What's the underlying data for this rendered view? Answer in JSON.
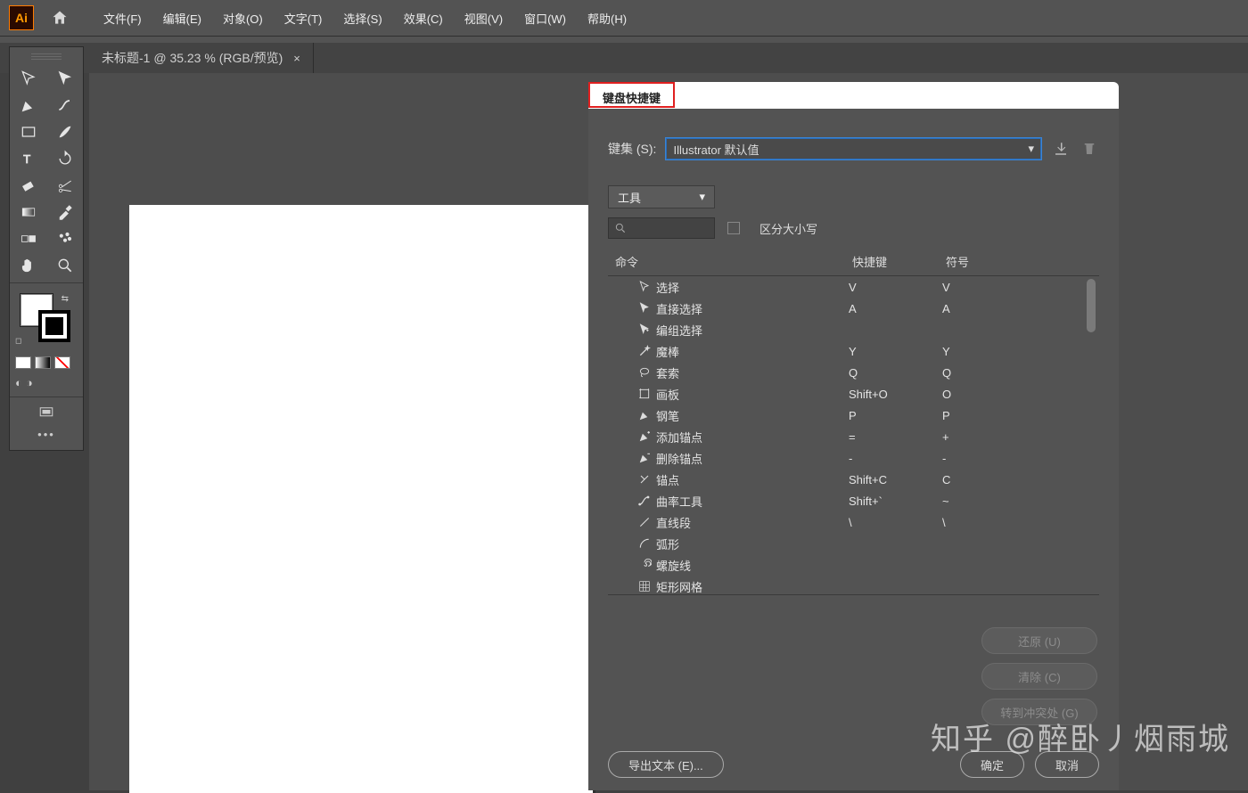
{
  "menubar": {
    "logo": "Ai",
    "items": [
      "文件(F)",
      "编辑(E)",
      "对象(O)",
      "文字(T)",
      "选择(S)",
      "效果(C)",
      "视图(V)",
      "窗口(W)",
      "帮助(H)"
    ]
  },
  "document_tab": {
    "title": "未标题-1 @ 35.23 % (RGB/预览)",
    "close": "×"
  },
  "dialog": {
    "title_tab": "键盘快捷键",
    "keyset_label": "键集 (S):",
    "keyset_value": "Illustrator 默认值",
    "filter_value": "工具",
    "case_sensitive_label": "区分大小写",
    "headers": {
      "command": "命令",
      "shortcut": "快捷键",
      "symbol": "符号"
    },
    "rows": [
      {
        "icon": "cursor",
        "cmd": "选择",
        "sc": "V",
        "sym": "V"
      },
      {
        "icon": "direct",
        "cmd": "直接选择",
        "sc": "A",
        "sym": "A"
      },
      {
        "icon": "group-sel",
        "cmd": "编组选择",
        "sc": "",
        "sym": ""
      },
      {
        "icon": "wand",
        "cmd": "魔棒",
        "sc": "Y",
        "sym": "Y"
      },
      {
        "icon": "lasso",
        "cmd": "套索",
        "sc": "Q",
        "sym": "Q"
      },
      {
        "icon": "artboard",
        "cmd": "画板",
        "sc": "Shift+O",
        "sym": "O"
      },
      {
        "icon": "pen",
        "cmd": "钢笔",
        "sc": "P",
        "sym": "P"
      },
      {
        "icon": "add-anchor",
        "cmd": "添加锚点",
        "sc": "=",
        "sym": "+"
      },
      {
        "icon": "del-anchor",
        "cmd": "删除锚点",
        "sc": "-",
        "sym": "-"
      },
      {
        "icon": "anchor",
        "cmd": "锚点",
        "sc": "Shift+C",
        "sym": "C"
      },
      {
        "icon": "curvature",
        "cmd": "曲率工具",
        "sc": "Shift+`",
        "sym": "~"
      },
      {
        "icon": "line",
        "cmd": "直线段",
        "sc": "\\",
        "sym": "\\"
      },
      {
        "icon": "arc",
        "cmd": "弧形",
        "sc": "",
        "sym": ""
      },
      {
        "icon": "spiral",
        "cmd": "螺旋线",
        "sc": "",
        "sym": ""
      },
      {
        "icon": "rect-grid",
        "cmd": "矩形网格",
        "sc": "",
        "sym": ""
      }
    ],
    "side_buttons": {
      "undo": "还原 (U)",
      "clear": "清除 (C)",
      "goto": "转到冲突处 (G)"
    },
    "bottom_buttons": {
      "export": "导出文本 (E)...",
      "ok": "确定",
      "cancel": "取消"
    }
  },
  "watermark": "知乎 @醉卧丿烟雨城"
}
